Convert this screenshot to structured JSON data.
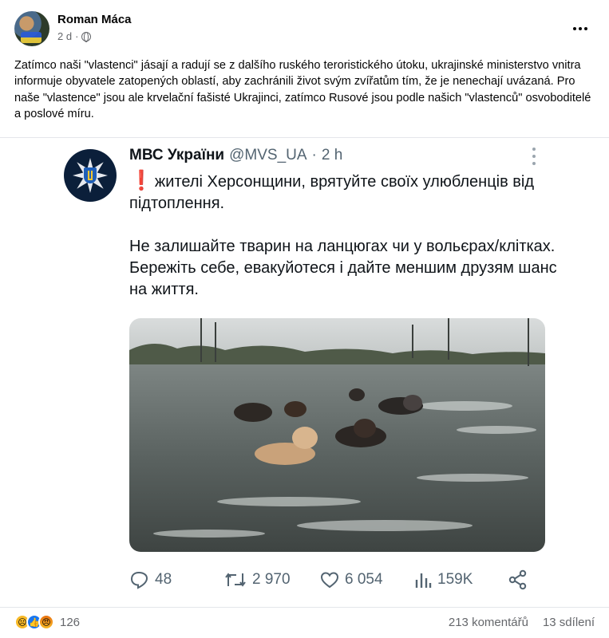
{
  "post": {
    "author": "Roman Máca",
    "time": "2 d",
    "audience_icon": "globe-icon",
    "more_icon": "more-horizontal-icon",
    "text": "Zatímco naši \"vlastenci\" jásají a radují se z dalšího ruského teroristického útoku, ukrajinské ministerstvo vnitra informuje obyvatele zatopených oblastí, aby zachránili život svým zvířatům tím, že je nenechají uvázaná. Pro naše \"vlastence\" jsou ale krvelační fašisté Ukrajinci, zatímco Rusové jsou podle našich \"vlastenců\" osvoboditelé a poslové míru."
  },
  "tweet": {
    "name": "МВС України",
    "handle": "@MVS_UA",
    "dot": "·",
    "time": "2 h",
    "exclamation": "❗",
    "line1": "жителі Херсонщини, врятуйте своїх улюбленців від підтоплення.",
    "line2": "Не залишайте тварин на ланцюгах чи у вольєрах/клітках. Бережіть себе, евакуйотеся і дайте меншим друзям шанс на життя.",
    "photo_icon": "flooded-street-dogs-photo",
    "actions": {
      "replies": "48",
      "retweets": "2 970",
      "likes": "6 054",
      "views": "159K"
    }
  },
  "footer": {
    "reaction_icons": [
      "sad-reaction-icon",
      "like-reaction-icon",
      "angry-reaction-icon"
    ],
    "reactions_count": "126",
    "comments": "213 komentářů",
    "shares": "13 sdílení"
  },
  "colors": {
    "accent_like": "#1877f2",
    "muted_text": "#65676b",
    "twitter_muted": "#536471",
    "exclamation": "#d6262b"
  }
}
